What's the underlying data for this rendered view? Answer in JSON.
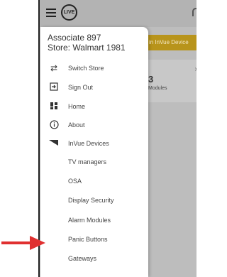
{
  "app": {
    "logo_text": "LIVE"
  },
  "banner": {
    "label": "in InVue Device",
    "color": "#b8941b"
  },
  "card": {
    "value": "3",
    "label": "Modules"
  },
  "drawer": {
    "associate": "Associate 897",
    "store": "Store: Walmart 1981",
    "items": [
      {
        "label": "Switch Store",
        "icon": "swap-icon"
      },
      {
        "label": "Sign Out",
        "icon": "sign-out-icon"
      },
      {
        "label": "Home",
        "icon": "dashboard-icon"
      },
      {
        "label": "About",
        "icon": "info-icon"
      },
      {
        "label": "InVue Devices",
        "icon": "triangle-icon"
      },
      {
        "label": "TV managers"
      },
      {
        "label": "OSA"
      },
      {
        "label": "Display Security"
      },
      {
        "label": "Alarm Modules"
      },
      {
        "label": "Panic Buttons"
      },
      {
        "label": "Gateways"
      }
    ]
  },
  "annotation": {
    "arrow_color": "#e03030",
    "arrow_icon": "red-arrow-icon"
  }
}
